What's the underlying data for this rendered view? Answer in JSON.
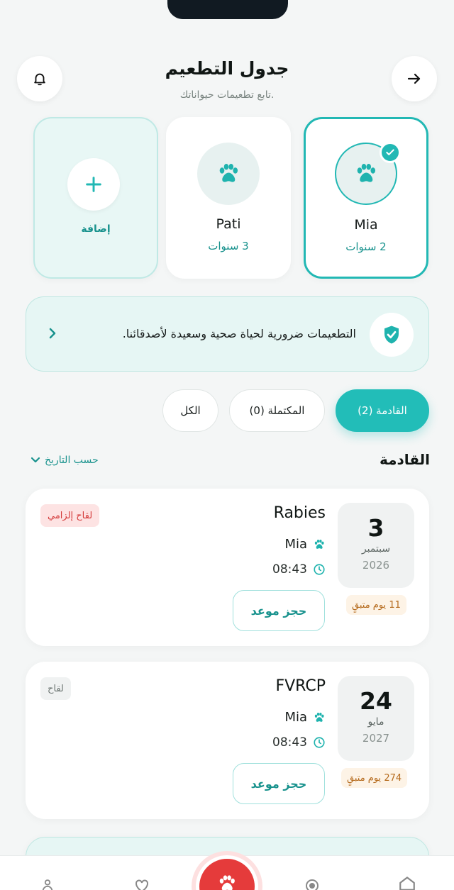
{
  "header": {
    "title": "جدول التطعيم",
    "subtitle": "تابع تطعيمات حيواناتك."
  },
  "pets": [
    {
      "name": "Mia",
      "age": "2 سنوات",
      "selected": true
    },
    {
      "name": "Pati",
      "age": "3 سنوات",
      "selected": false
    }
  ],
  "add_pet_label": "إضافة",
  "banner": {
    "text": "التطعيمات ضرورية لحياة صحية وسعيدة لأصدقائنا."
  },
  "tabs": [
    {
      "label": "القادمة (2)",
      "active": true
    },
    {
      "label": "المكتملة (0)",
      "active": false
    },
    {
      "label": "الكل",
      "active": false
    }
  ],
  "section": {
    "title": "القادمة",
    "sort_label": "حسب التاريخ"
  },
  "appointments": [
    {
      "day": "3",
      "month": "سبتمبر",
      "year": "2026",
      "remaining": "11 يوم متبقٍ",
      "vaccine": "Rabies",
      "pet": "Mia",
      "time": "08:43",
      "book_label": "حجز موعد",
      "tag": "لقاح إلزامي"
    },
    {
      "day": "24",
      "month": "مايو",
      "year": "2027",
      "remaining": "274 يوم متبقٍ",
      "vaccine": "FVRCP",
      "pet": "Mia",
      "time": "08:43",
      "book_label": "حجز موعد",
      "tag": "لقاح"
    }
  ],
  "colors": {
    "accent": "#22bdb8",
    "accent_dark": "#18928d",
    "danger": "#e53b3b",
    "background": "#f4f6f6"
  },
  "icons": [
    "bell-icon",
    "arrow-right-icon",
    "paw-icon",
    "check-icon",
    "plus-icon",
    "shield-check-icon",
    "chevron-left-icon",
    "chevron-down-icon",
    "clock-icon",
    "user-icon",
    "heart-icon",
    "location-icon",
    "home-icon"
  ]
}
